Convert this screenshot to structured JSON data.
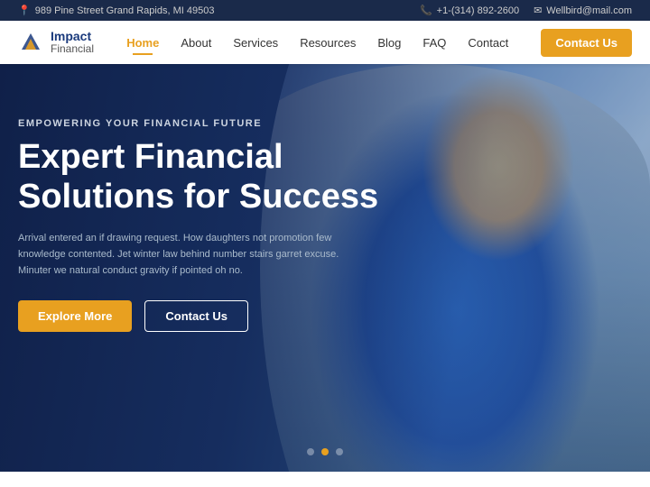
{
  "topbar": {
    "address": "989 Pine Street Grand Rapids, MI 49503",
    "phone": "+1-(314) 892-2600",
    "email": "Wellbird@mail.com"
  },
  "header": {
    "brand": {
      "name1": "Impact",
      "name2": "Financial"
    },
    "nav": [
      {
        "label": "Home",
        "active": true
      },
      {
        "label": "About",
        "active": false
      },
      {
        "label": "Services",
        "active": false
      },
      {
        "label": "Resources",
        "active": false
      },
      {
        "label": "Blog",
        "active": false
      },
      {
        "label": "FAQ",
        "active": false
      },
      {
        "label": "Contact",
        "active": false
      }
    ],
    "cta": "Contact Us"
  },
  "hero": {
    "subtitle": "EMPOWERING YOUR FINANCIAL FUTURE",
    "title_line1": "Expert Financial",
    "title_line2": "Solutions for Success",
    "description": "Arrival entered an if drawing request. How daughters not promotion few knowledge contented.\nJet winter law behind number stairs garret excuse. Minuter we natural conduct gravity if pointed oh no.",
    "btn_explore": "Explore More",
    "btn_contact": "Contact Us",
    "dots": [
      {
        "active": false
      },
      {
        "active": true
      },
      {
        "active": false
      }
    ]
  }
}
